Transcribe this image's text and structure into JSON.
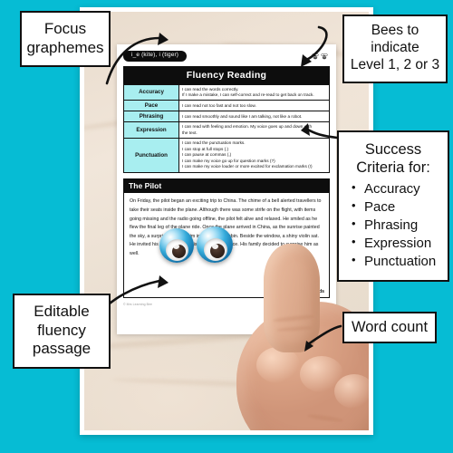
{
  "theme": {
    "background_color": "#06bcd4",
    "accent_table_header_color": "#a8eef0",
    "dark_color": "#0d0d0d",
    "card_color": "#ffffff"
  },
  "worksheet": {
    "grapheme_badge": "i_e (kite), i (tiger)",
    "bee_icons": [
      "bee-icon",
      "bee-icon"
    ],
    "fluency_title": "Fluency Reading",
    "criteria_rows": [
      {
        "label": "Accuracy",
        "lines": [
          "I can read the words correctly.",
          "If I make a mistake, I can self-correct and re-read to get back on track."
        ]
      },
      {
        "label": "Pace",
        "lines": [
          "I can read not too fast and not too slow."
        ]
      },
      {
        "label": "Phrasing",
        "lines": [
          "I can read smoothly and sound like I am talking, not like a robot."
        ]
      },
      {
        "label": "Expression",
        "lines": [
          "I can read with feeling and emotion. My voice goes up and down with",
          "the text."
        ]
      },
      {
        "label": "Punctuation",
        "lines": [
          "I can read the punctuation marks.",
          "I can stop at full stops (.)",
          "I can pause at commas (,)",
          "I can make my voice go up for question marks (?)",
          "I can make my voice louder or more excited for exclamation marks (!)"
        ]
      }
    ],
    "passage_title": "The Pilot",
    "passage_text": "On Friday, the pilot began an exciting trip to China. The chime of a bell alerted travellers to take their seats inside the plane. Although there was some strife on the flight, with items going missing and the radio going offline, the pilot felt alive and relaxed. He smiled as he flew the final leg of the plane ride. Once the plane arrived in China, as the sunrise painted the sky, a surprise awaited him in the inviting cabin. Beside the window, a shiny violin sat. He invited his pilot friends to his violin performance. His family decided to surprise him as well.",
    "word_count": "106 words",
    "copyright": "© Mrs Learning Bee"
  },
  "callouts": {
    "focus": [
      "Focus",
      "graphemes"
    ],
    "bees": [
      "Bees to",
      "indicate",
      "Level 1, 2 or 3"
    ],
    "success_heading": [
      "Success",
      "Criteria for:"
    ],
    "success_items": [
      "Accuracy",
      "Pace",
      "Phrasing",
      "Expression",
      "Punctuation"
    ],
    "editable": [
      "Editable",
      "fluency",
      "passage"
    ],
    "wordcount": [
      "Word count"
    ]
  },
  "props": {
    "googly_eye_left": "googly-eye",
    "googly_eye_right": "googly-eye",
    "hand": "hand-pointing"
  }
}
